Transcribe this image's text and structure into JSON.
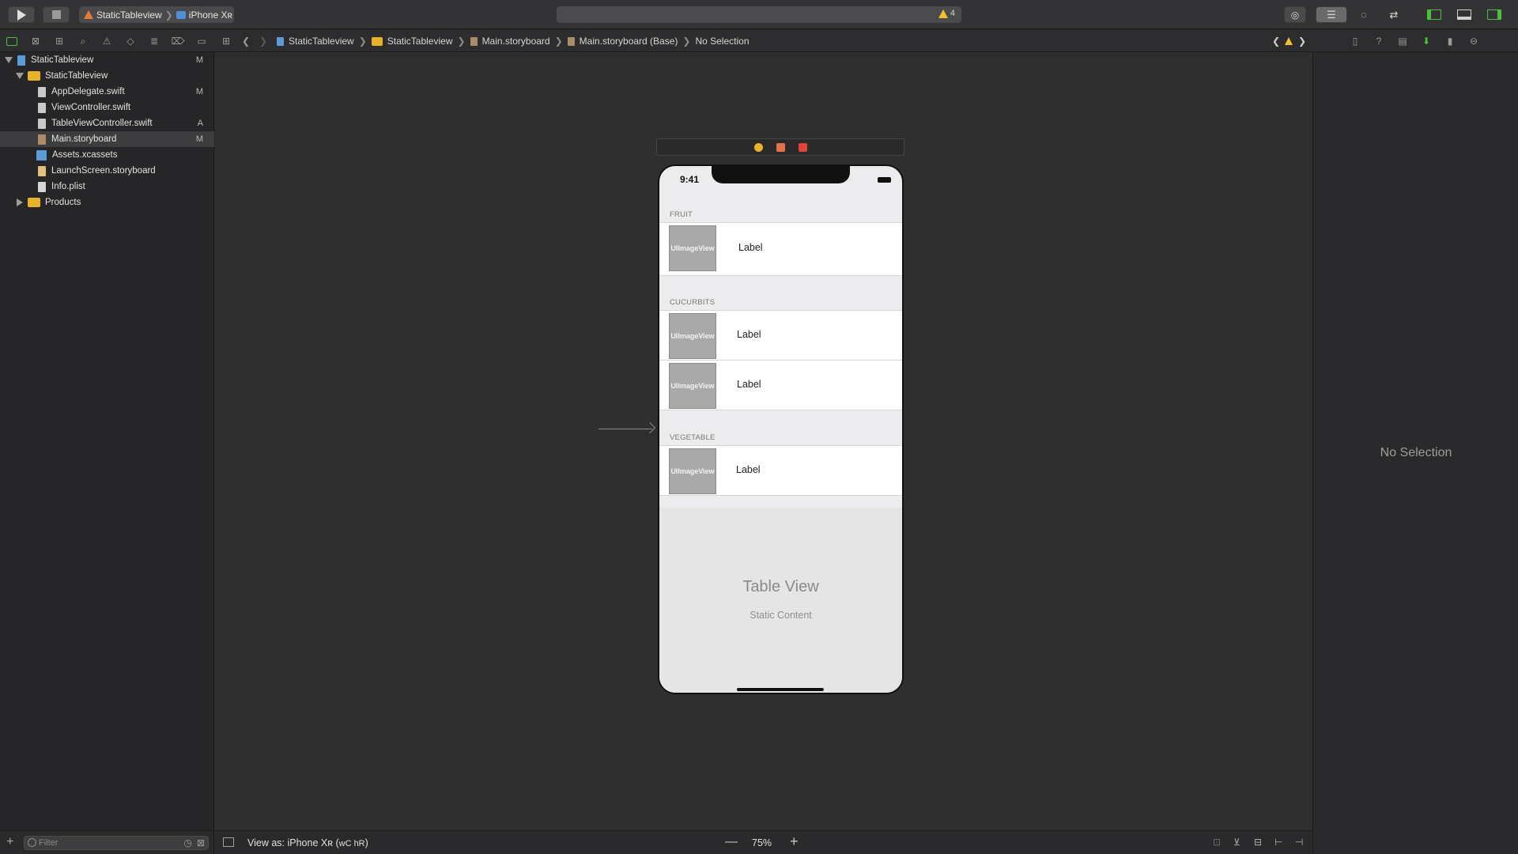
{
  "toolbar": {
    "scheme_project": "StaticTableview",
    "scheme_device": "iPhone Xʀ",
    "warning_count": "4"
  },
  "jumpbar": {
    "items": [
      "StaticTableview",
      "StaticTableview",
      "Main.storyboard",
      "Main.storyboard (Base)",
      "No Selection"
    ]
  },
  "navigator": {
    "items": [
      {
        "label": "StaticTableview",
        "badge": "M"
      },
      {
        "label": "StaticTableview",
        "badge": ""
      },
      {
        "label": "AppDelegate.swift",
        "badge": "M"
      },
      {
        "label": "ViewController.swift",
        "badge": ""
      },
      {
        "label": "TableViewController.swift",
        "badge": "A"
      },
      {
        "label": "Main.storyboard",
        "badge": "M"
      },
      {
        "label": "Assets.xcassets",
        "badge": ""
      },
      {
        "label": "LaunchScreen.storyboard",
        "badge": ""
      },
      {
        "label": "Info.plist",
        "badge": ""
      },
      {
        "label": "Products",
        "badge": ""
      }
    ],
    "filter_placeholder": "Filter"
  },
  "scene": {
    "time": "9:41",
    "sections": [
      {
        "header": "FRUIT",
        "rows": [
          {
            "image": "UIImageView",
            "label": "Label"
          }
        ]
      },
      {
        "header": "CUCURBITS",
        "rows": [
          {
            "image": "UIImageView",
            "label": "Label"
          },
          {
            "image": "UIImageView",
            "label": "Label"
          }
        ]
      },
      {
        "header": "VEGETABLE",
        "rows": [
          {
            "image": "UIImageView",
            "label": "Label"
          }
        ]
      }
    ],
    "table_title": "Table View",
    "table_subtitle": "Static Content"
  },
  "editor_bottom": {
    "view_as": "View as: iPhone Xʀ (",
    "traits": "wC hR",
    "zoom": "75%"
  },
  "inspector": {
    "empty_text": "No Selection"
  },
  "colors": {
    "accent_green": "#4cbf3f",
    "warning_yellow": "#f3c02d"
  }
}
